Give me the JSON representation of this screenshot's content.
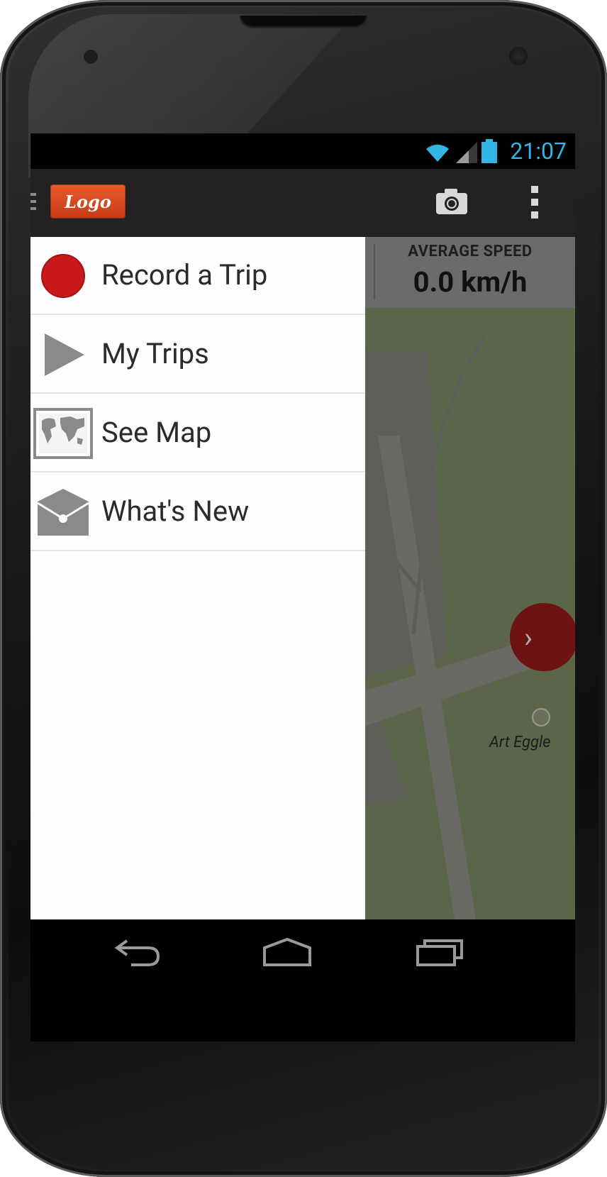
{
  "status": {
    "time": "21:07"
  },
  "actionbar": {
    "logo_text": "Logo"
  },
  "speed": {
    "label": "AVERAGE SPEED",
    "value": "0.0 km/h"
  },
  "map": {
    "poi_label": "Art Eggle"
  },
  "drawer": {
    "items": [
      {
        "label": "Record a Trip",
        "icon": "record-icon"
      },
      {
        "label": "My Trips",
        "icon": "play-icon"
      },
      {
        "label": "See Map",
        "icon": "world-map-icon"
      },
      {
        "label": "What's New",
        "icon": "envelope-icon"
      }
    ]
  },
  "colors": {
    "accent": "#33b5e5",
    "record": "#c81a1a",
    "logo": "#d94a22"
  }
}
